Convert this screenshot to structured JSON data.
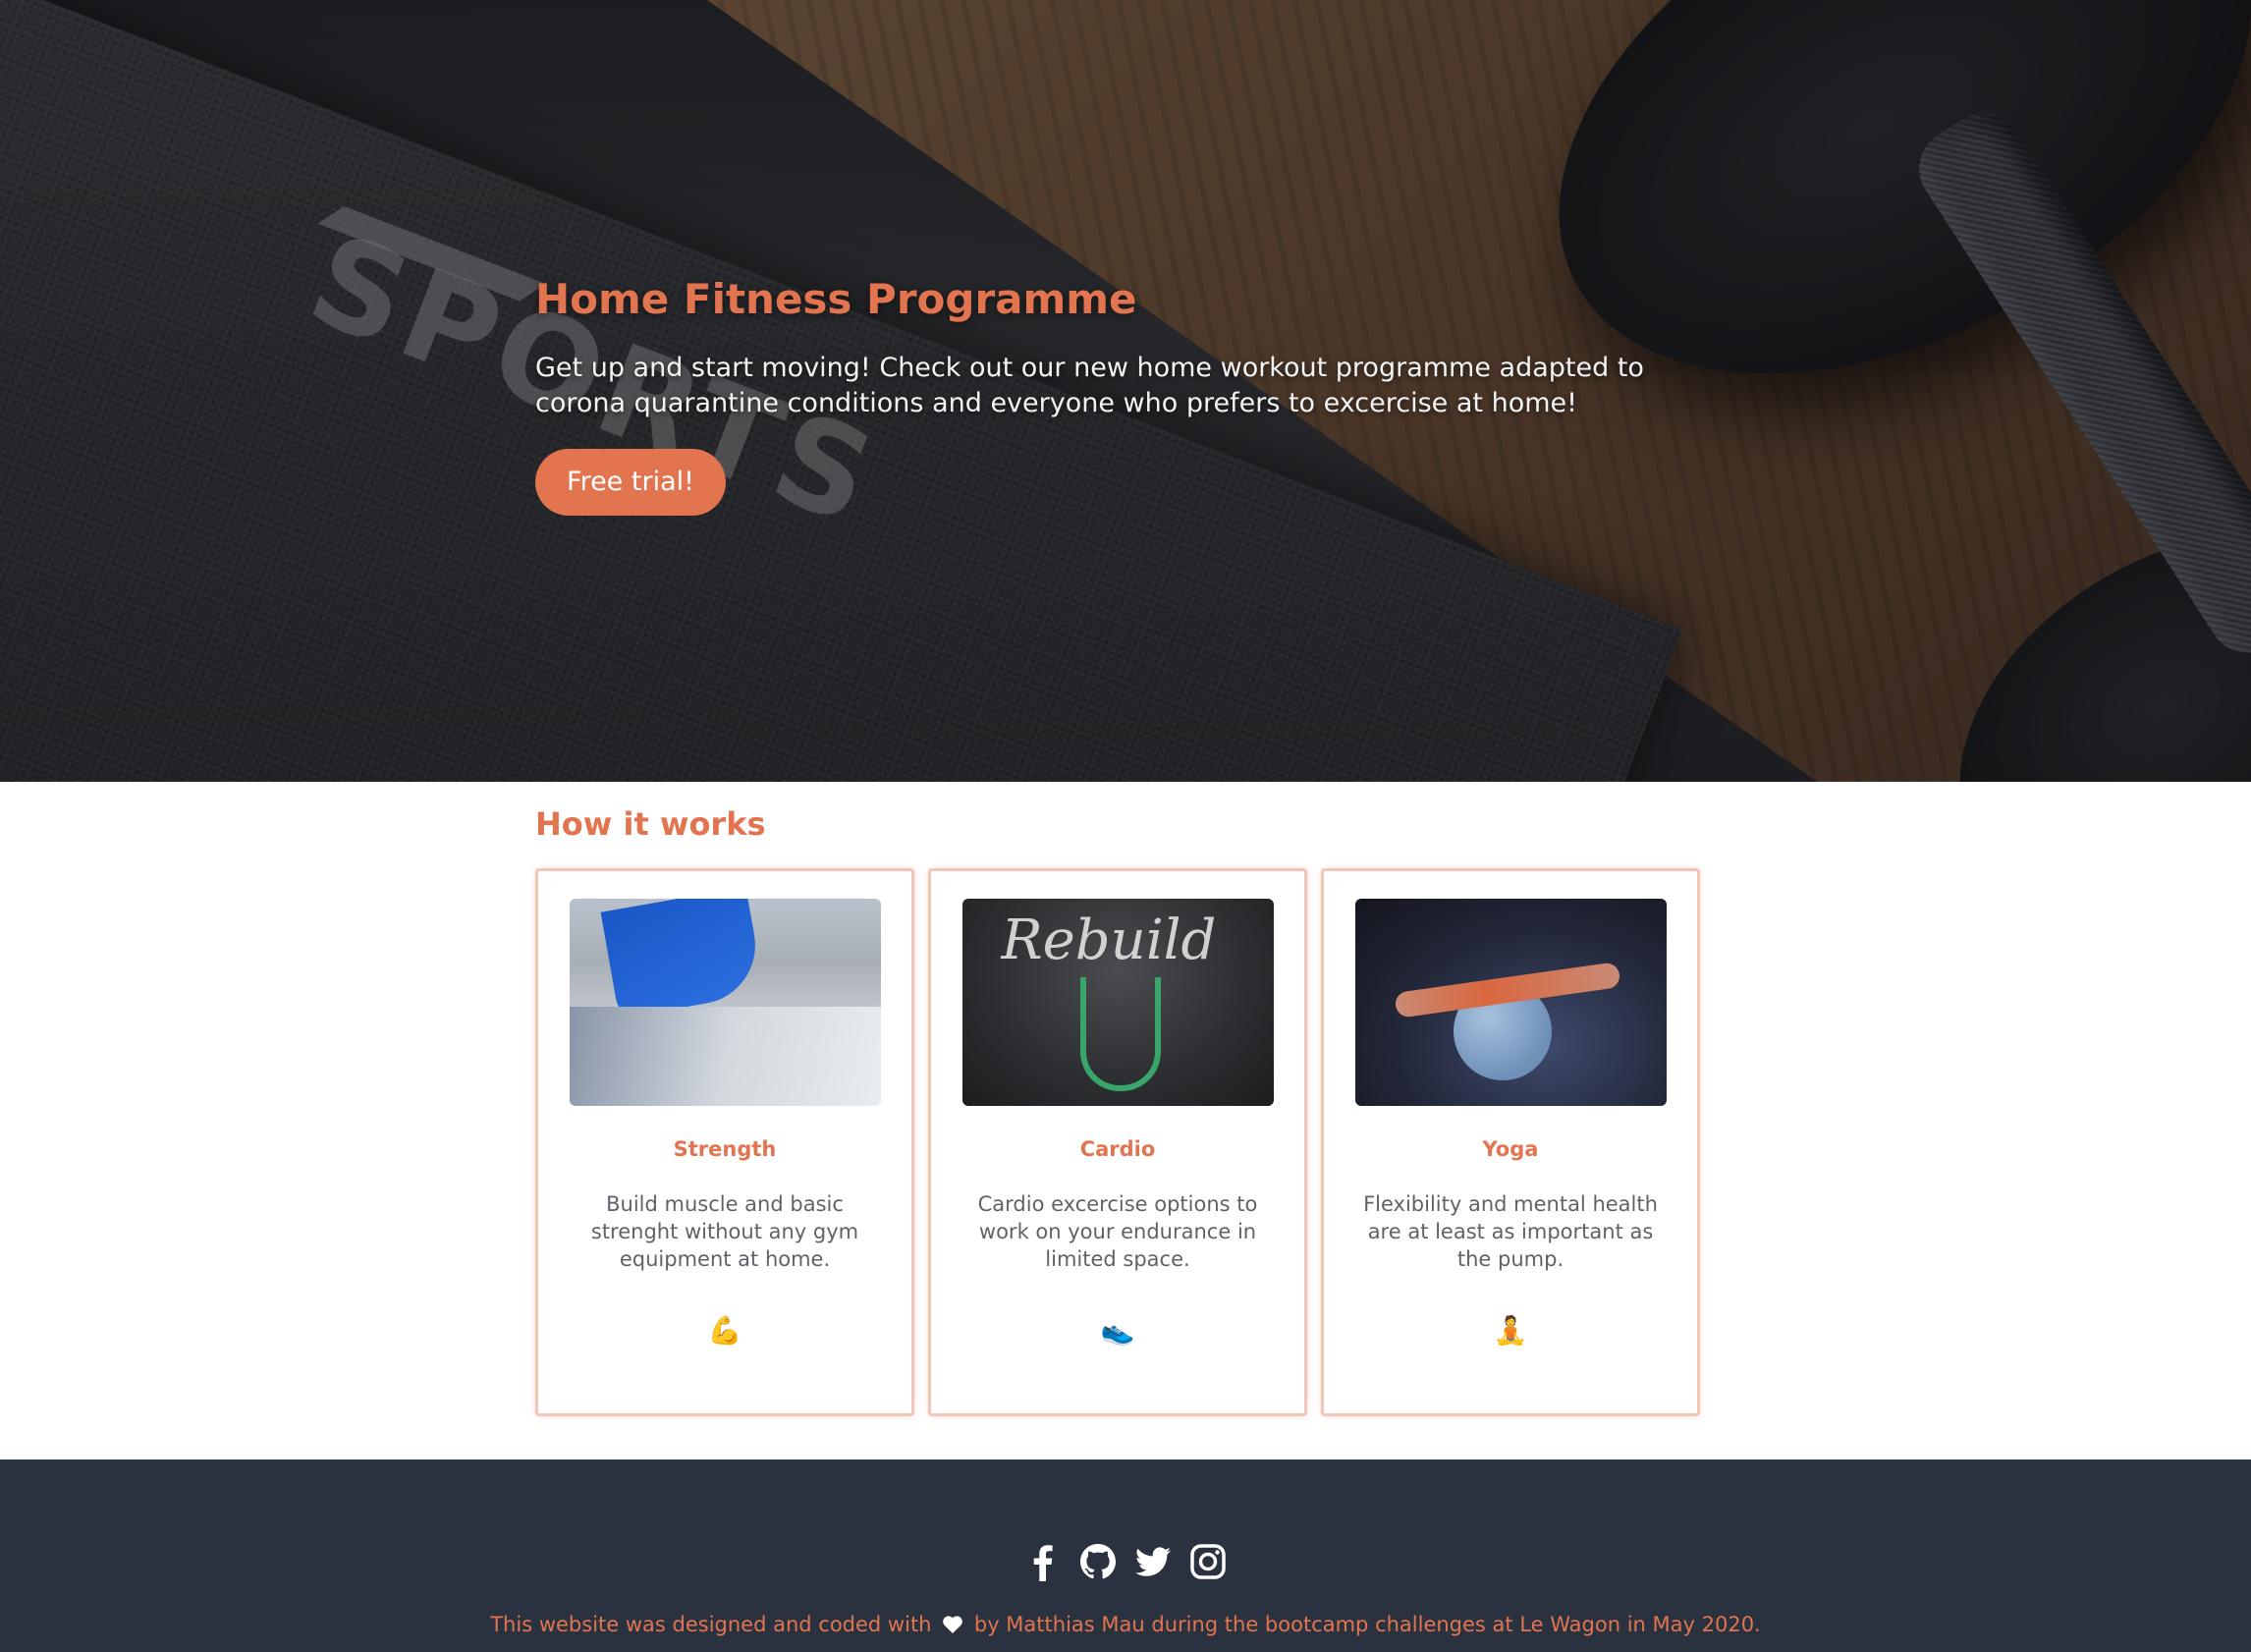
{
  "hero": {
    "title": "Home Fitness Programme",
    "subtitle": "Get up and start moving! Check out our new home workout programme adapted to corona quarantine conditions and everyone who prefers to excercise at home!",
    "cta_label": "Free trial!",
    "background_logo_text": "SPORTS"
  },
  "how_it_works": {
    "title": "How it works",
    "cards": [
      {
        "title": "Strength",
        "text": "Build muscle and basic strenght without any gym equipment at home.",
        "emoji": "💪"
      },
      {
        "title": "Cardio",
        "text": "Cardio excercise options to work on your endurance in limited space.",
        "emoji": "👟"
      },
      {
        "title": "Yoga",
        "text": "Flexibility and mental health are at least as important as the pump.",
        "emoji": "🧘"
      }
    ]
  },
  "footer": {
    "social_icons": [
      "facebook-icon",
      "github-icon",
      "twitter-icon",
      "instagram-icon"
    ],
    "text_before": "This website was designed and coded with",
    "text_after": "by Matthias Mau during the bootcamp challenges at Le Wagon in May 2020."
  },
  "colors": {
    "accent": "#e27450",
    "footer_bg": "#2b323f",
    "card_border": "#f3c7b8",
    "body_text": "#5f6368"
  }
}
